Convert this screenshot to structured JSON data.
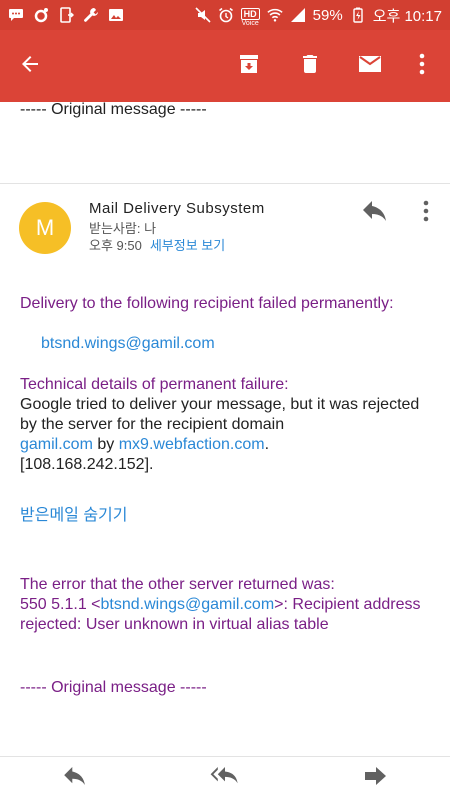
{
  "status_bar": {
    "hd_label": "HD",
    "voice_label": "Voice",
    "battery": "59%",
    "time": "오후 10:17"
  },
  "toolbar": {
    "icons": [
      "back-arrow-icon",
      "archive-icon",
      "delete-icon",
      "mail-icon",
      "more-vert-icon"
    ],
    "accent": "#db4437"
  },
  "thread": {
    "previous_original": "----- Original message -----"
  },
  "message": {
    "avatar_letter": "M",
    "avatar_color": "#f6bf26",
    "sender": "Mail Delivery Subsystem",
    "recipient": "받는사람: 나",
    "time": "오후 9:50",
    "details_link": "세부정보 보기"
  },
  "body": {
    "delivery_failed": "Delivery to the following recipient failed permanently:",
    "failed_recipient": "btsnd.wings@gamil.com",
    "technical_heading": "Technical details of permanent failure:",
    "technical_text_1": "Google tried to deliver your message, but it was rejected by the server for the recipient domain",
    "domain_link": "gamil.com",
    "by_word": "by",
    "server_link": "mx9.webfaction.com",
    "period": ".",
    "ip_address": "[108.168.242.152].",
    "hide_quoted": "받은메일 숨기기",
    "error_heading": "The error that the other server returned was:",
    "error_code_prefix": "550 5.1.1 <",
    "error_email": "btsnd.wings@gamil.com",
    "error_message_suffix": ">: Recipient address rejected: User unknown in virtual alias table",
    "original_message": "----- Original message -----"
  },
  "bottom_bar": {
    "icons": [
      "reply-icon",
      "reply-all-icon",
      "forward-icon"
    ]
  }
}
